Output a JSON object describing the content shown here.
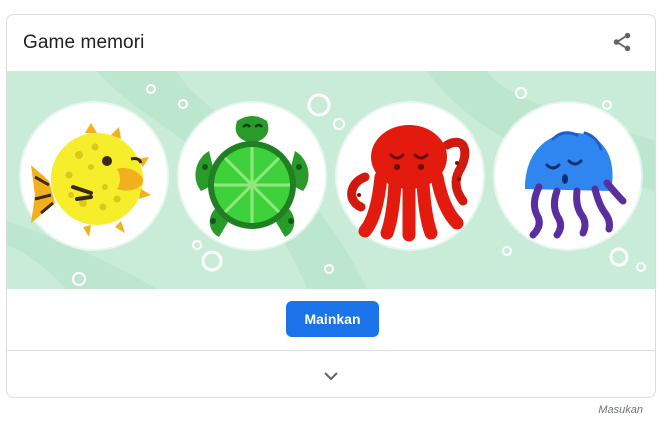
{
  "card": {
    "title": "Game memori",
    "play_label": "Mainkan"
  },
  "icons": {
    "share": "share-icon",
    "expand": "chevron-down-icon"
  },
  "tiles": [
    {
      "animal": "pufferfish",
      "color": "#f5e92a"
    },
    {
      "animal": "turtle",
      "color": "#2fc62b"
    },
    {
      "animal": "octopus",
      "color": "#e31b0f"
    },
    {
      "animal": "jellyfish",
      "color": "#2f86f0"
    }
  ],
  "colors": {
    "accent": "#1a73e8",
    "banner_bg": "#c9ecd9"
  },
  "footer": {
    "feedback_label": "Masukan"
  }
}
